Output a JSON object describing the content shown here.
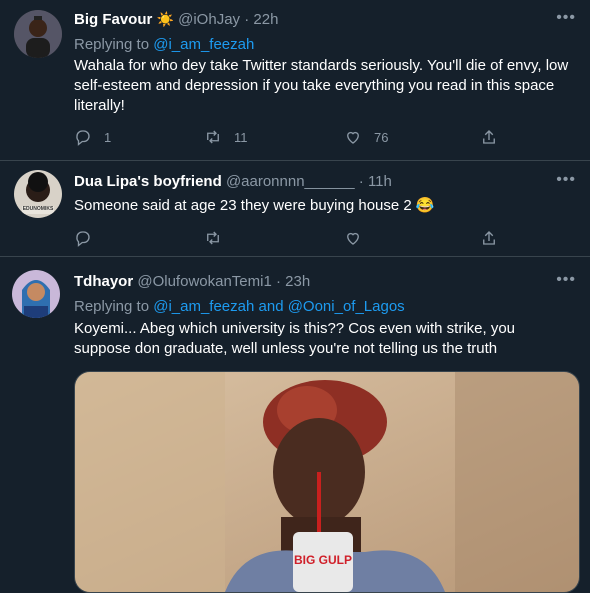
{
  "tweets": [
    {
      "name": "Big Favour",
      "emoji": "☀️",
      "handle": "@iOhJay",
      "sep": "·",
      "time": "22h",
      "replying_prefix": "Replying to",
      "replying_to": "@i_am_feezah",
      "text": "Wahala for who dey take Twitter standards seriously. You'll die of envy, low self-esteem and depression if you take everything you read in this space literally!",
      "replies": "1",
      "retweets": "11",
      "likes": "76"
    },
    {
      "name": "Dua Lipa's boyfriend",
      "handle": "@aaronnnn______",
      "sep": "·",
      "time": "11h",
      "text": "Someone said at age 23 they were buying house 2 😂",
      "avatar_caption": "EDUNOMIKS"
    },
    {
      "name": "Tdhayor",
      "handle": "@OlufowokanTemi1",
      "sep": "·",
      "time": "23h",
      "replying_prefix": "Replying to",
      "replying_to": "@i_am_feezah and @Ooni_of_Lagos",
      "text": "Koyemi... Abeg which university is this?? Cos even with strike, you suppose don graduate, well unless you're not telling us the truth",
      "cup_text": "BIG GULP"
    }
  ],
  "icons": {
    "more": "more-icon",
    "reply": "reply-icon",
    "retweet": "retweet-icon",
    "like": "like-icon",
    "share": "share-icon"
  },
  "colors": {
    "background": "#15202b",
    "muted": "#8b98a5",
    "link": "#1d9bf0",
    "divider": "#38444d"
  }
}
